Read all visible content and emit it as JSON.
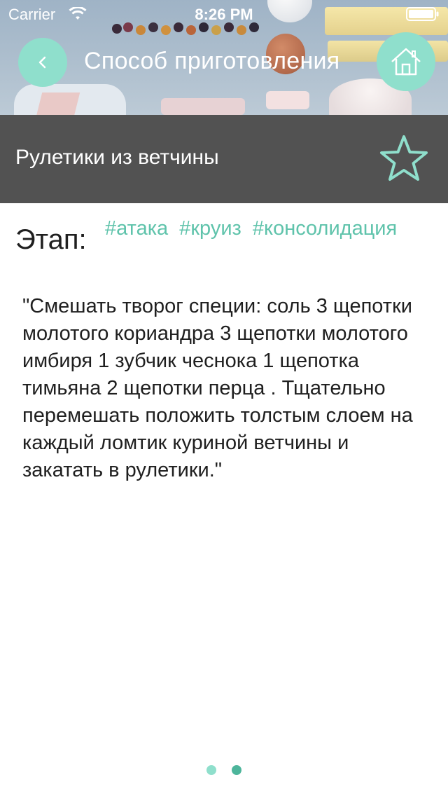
{
  "status_bar": {
    "carrier": "Carrier",
    "time": "8:26 PM",
    "wifi_icon": "wifi-icon",
    "battery_icon": "battery-icon"
  },
  "nav": {
    "title": "Способ приготовления",
    "back_icon": "chevron-left-icon",
    "home_icon": "home-icon"
  },
  "recipe": {
    "title": "Рулетики из ветчины",
    "favorite_icon": "star-outline-icon"
  },
  "content": {
    "stage_label": "Этап:",
    "tags": [
      "#атака",
      "#круиз",
      "#консолидация"
    ],
    "description": "\"Смешать творог специи: соль 3 щепотки молотого кориандра 3 щепотки молотого имбиря 1 зубчик чеснока 1 щепотка тимьяна 2 щепотки перца . Тщательно перемешать положить толстым слоем на каждый ломтик куриной ветчины и закатать в рулетики.\""
  },
  "pager": {
    "page_count": 2,
    "current_page": 2
  },
  "colors": {
    "accent": "#5fc3ab",
    "nav_button": "#8fdfcc",
    "title_bar": "#525252",
    "dot_inactive": "#8fdfcc",
    "dot_active": "#4db59b",
    "text": "#1f1f1f"
  }
}
